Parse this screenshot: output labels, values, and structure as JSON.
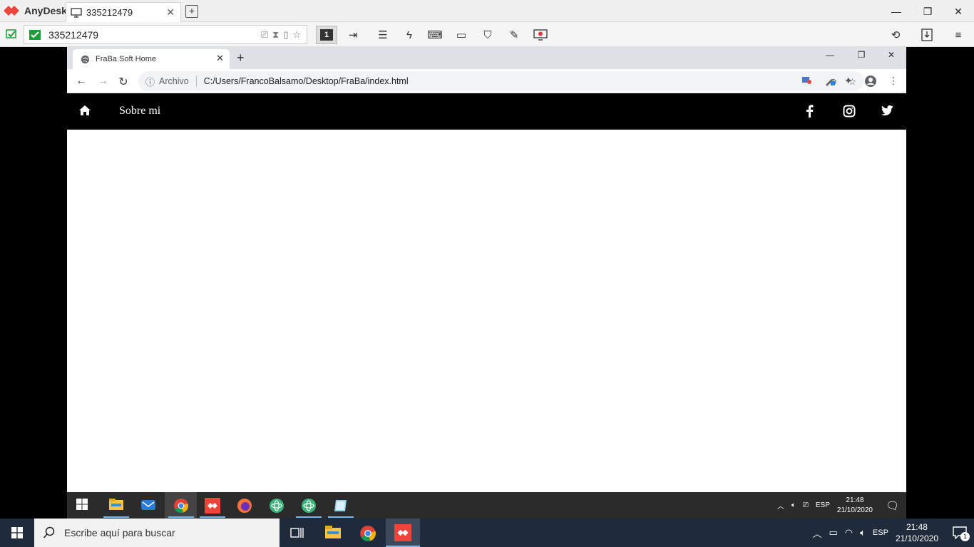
{
  "anydesk": {
    "app_name": "AnyDesk",
    "tab_label": "335212479",
    "address_value": "335212479",
    "monitor_number": "1",
    "accent": "#ef443b"
  },
  "chrome": {
    "tab_title": "FraBa Soft Home",
    "omni_scheme_label": "Archivo",
    "url": "C:/Users/FrancoBalsamo/Desktop/FraBa/index.html"
  },
  "page": {
    "nav_link": "Sobre mi",
    "nav_background": "#000000",
    "social_icons": [
      "facebook-icon",
      "instagram-icon",
      "twitter-icon"
    ]
  },
  "remote_taskbar": {
    "lang": "ESP",
    "time": "21:48",
    "date": "21/10/2020"
  },
  "local_taskbar": {
    "search_placeholder": "Escribe aquí para buscar",
    "lang": "ESP",
    "time": "21:48",
    "date": "21/10/2020",
    "notification_count": "1"
  }
}
